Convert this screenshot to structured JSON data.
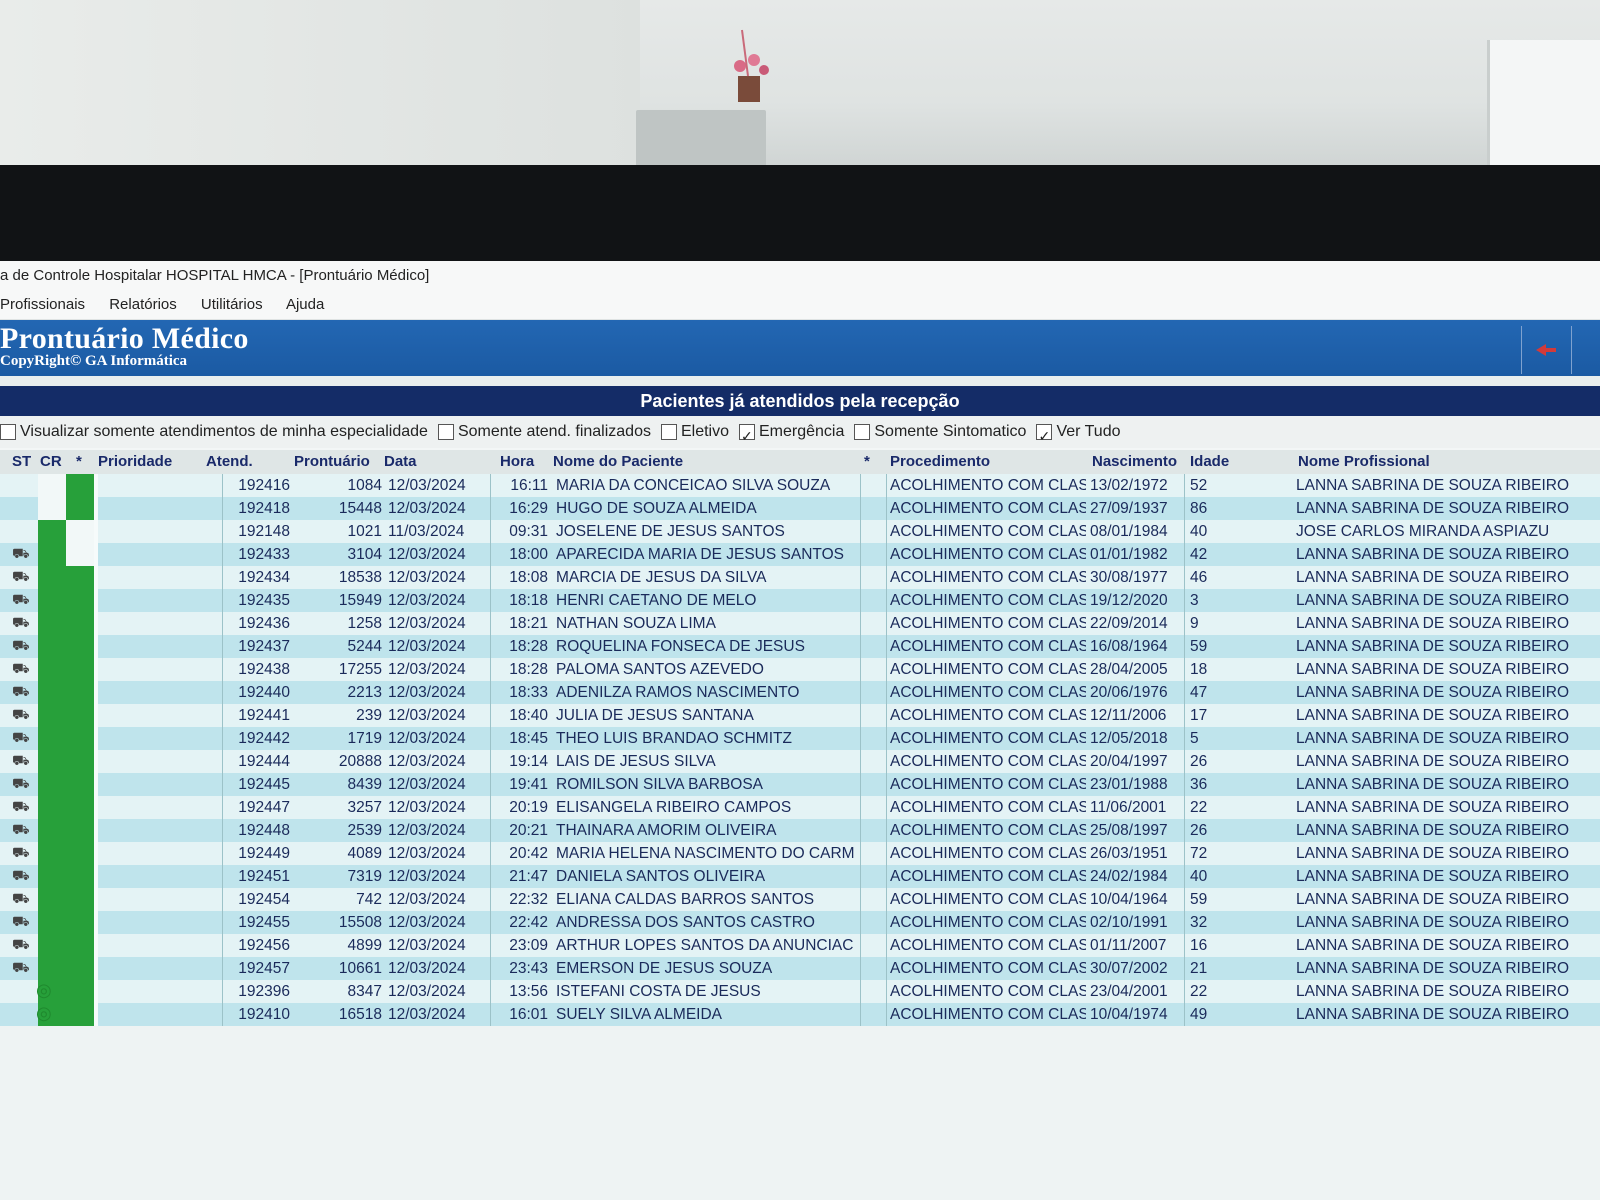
{
  "window": {
    "title": "a de Controle Hospitalar HOSPITAL HMCA - [Prontuário Médico]"
  },
  "menu": [
    "Profissionais",
    "Relatórios",
    "Utilitários",
    "Ajuda"
  ],
  "banner": {
    "title": "Prontuário Médico",
    "subtitle": "CopyRight© GA Informática"
  },
  "section_title": "Pacientes já atendidos pela recepção",
  "filters": [
    {
      "label": "Visualizar somente atendimentos de minha especialidade",
      "checked": false
    },
    {
      "label": "Somente atend. finalizados",
      "checked": false
    },
    {
      "label": "Eletivo",
      "checked": false
    },
    {
      "label": "Emergência",
      "checked": true
    },
    {
      "label": "Somente Sintomatico",
      "checked": false
    },
    {
      "label": "Ver Tudo",
      "checked": true
    }
  ],
  "columns": {
    "st": "ST",
    "cr": "CR",
    "star": "*",
    "prioridade": "Prioridade",
    "atend": "Atend.",
    "prontuario": "Prontuário",
    "data": "Data",
    "hora": "Hora",
    "nome": "Nome do Paciente",
    "star2": "*",
    "procedimento": "Procedimento",
    "nascimento": "Nascimento",
    "idade": "Idade",
    "profissional": "Nome Profissional"
  },
  "rows": [
    {
      "atend": "192416",
      "prontuario": "1084",
      "data": "12/03/2024",
      "hora": "16:11",
      "nome": "MARIA DA CONCEICAO SILVA SOUZA",
      "procedimento": "ACOLHIMENTO COM CLAS",
      "nascimento": "13/02/1972",
      "idade": "52",
      "profissional": "LANNA SABRINA DE SOUZA RIBEIRO"
    },
    {
      "atend": "192418",
      "prontuario": "15448",
      "data": "12/03/2024",
      "hora": "16:29",
      "nome": "HUGO DE SOUZA ALMEIDA",
      "procedimento": "ACOLHIMENTO COM CLAS",
      "nascimento": "27/09/1937",
      "idade": "86",
      "profissional": "LANNA SABRINA DE SOUZA RIBEIRO"
    },
    {
      "atend": "192148",
      "prontuario": "1021",
      "data": "11/03/2024",
      "hora": "09:31",
      "nome": "JOSELENE DE JESUS SANTOS",
      "procedimento": "ACOLHIMENTO COM CLAS",
      "nascimento": "08/01/1984",
      "idade": "40",
      "profissional": "JOSE CARLOS MIRANDA ASPIAZU"
    },
    {
      "atend": "192433",
      "prontuario": "3104",
      "data": "12/03/2024",
      "hora": "18:00",
      "nome": "APARECIDA MARIA DE JESUS SANTOS",
      "procedimento": "ACOLHIMENTO COM CLAS",
      "nascimento": "01/01/1982",
      "idade": "42",
      "profissional": "LANNA SABRINA DE SOUZA RIBEIRO"
    },
    {
      "atend": "192434",
      "prontuario": "18538",
      "data": "12/03/2024",
      "hora": "18:08",
      "nome": "MARCIA DE JESUS DA SILVA",
      "procedimento": "ACOLHIMENTO COM CLAS",
      "nascimento": "30/08/1977",
      "idade": "46",
      "profissional": "LANNA SABRINA DE SOUZA RIBEIRO"
    },
    {
      "atend": "192435",
      "prontuario": "15949",
      "data": "12/03/2024",
      "hora": "18:18",
      "nome": "HENRI CAETANO DE MELO",
      "procedimento": "ACOLHIMENTO COM CLAS",
      "nascimento": "19/12/2020",
      "idade": "3",
      "profissional": "LANNA SABRINA DE SOUZA RIBEIRO"
    },
    {
      "atend": "192436",
      "prontuario": "1258",
      "data": "12/03/2024",
      "hora": "18:21",
      "nome": "NATHAN SOUZA LIMA",
      "procedimento": "ACOLHIMENTO COM CLAS",
      "nascimento": "22/09/2014",
      "idade": "9",
      "profissional": "LANNA SABRINA DE SOUZA RIBEIRO"
    },
    {
      "atend": "192437",
      "prontuario": "5244",
      "data": "12/03/2024",
      "hora": "18:28",
      "nome": "ROQUELINA FONSECA DE JESUS",
      "procedimento": "ACOLHIMENTO COM CLAS",
      "nascimento": "16/08/1964",
      "idade": "59",
      "profissional": "LANNA SABRINA DE SOUZA RIBEIRO"
    },
    {
      "atend": "192438",
      "prontuario": "17255",
      "data": "12/03/2024",
      "hora": "18:28",
      "nome": "PALOMA SANTOS AZEVEDO",
      "procedimento": "ACOLHIMENTO COM CLAS",
      "nascimento": "28/04/2005",
      "idade": "18",
      "profissional": "LANNA SABRINA DE SOUZA RIBEIRO"
    },
    {
      "atend": "192440",
      "prontuario": "2213",
      "data": "12/03/2024",
      "hora": "18:33",
      "nome": "ADENILZA RAMOS NASCIMENTO",
      "procedimento": "ACOLHIMENTO COM CLAS",
      "nascimento": "20/06/1976",
      "idade": "47",
      "profissional": "LANNA SABRINA DE SOUZA RIBEIRO"
    },
    {
      "atend": "192441",
      "prontuario": "239",
      "data": "12/03/2024",
      "hora": "18:40",
      "nome": "JULIA DE JESUS SANTANA",
      "procedimento": "ACOLHIMENTO COM CLAS",
      "nascimento": "12/11/2006",
      "idade": "17",
      "profissional": "LANNA SABRINA DE SOUZA RIBEIRO"
    },
    {
      "atend": "192442",
      "prontuario": "1719",
      "data": "12/03/2024",
      "hora": "18:45",
      "nome": "THEO LUIS BRANDAO SCHMITZ",
      "procedimento": "ACOLHIMENTO COM CLAS",
      "nascimento": "12/05/2018",
      "idade": "5",
      "profissional": "LANNA SABRINA DE SOUZA RIBEIRO"
    },
    {
      "atend": "192444",
      "prontuario": "20888",
      "data": "12/03/2024",
      "hora": "19:14",
      "nome": "LAIS DE JESUS SILVA",
      "procedimento": "ACOLHIMENTO COM CLAS",
      "nascimento": "20/04/1997",
      "idade": "26",
      "profissional": "LANNA SABRINA DE SOUZA RIBEIRO"
    },
    {
      "atend": "192445",
      "prontuario": "8439",
      "data": "12/03/2024",
      "hora": "19:41",
      "nome": "ROMILSON SILVA BARBOSA",
      "procedimento": "ACOLHIMENTO COM CLAS",
      "nascimento": "23/01/1988",
      "idade": "36",
      "profissional": "LANNA SABRINA DE SOUZA RIBEIRO"
    },
    {
      "atend": "192447",
      "prontuario": "3257",
      "data": "12/03/2024",
      "hora": "20:19",
      "nome": "ELISANGELA RIBEIRO CAMPOS",
      "procedimento": "ACOLHIMENTO COM CLAS",
      "nascimento": "11/06/2001",
      "idade": "22",
      "profissional": "LANNA SABRINA DE SOUZA RIBEIRO"
    },
    {
      "atend": "192448",
      "prontuario": "2539",
      "data": "12/03/2024",
      "hora": "20:21",
      "nome": "THAINARA AMORIM OLIVEIRA",
      "procedimento": "ACOLHIMENTO COM CLAS",
      "nascimento": "25/08/1997",
      "idade": "26",
      "profissional": "LANNA SABRINA DE SOUZA RIBEIRO"
    },
    {
      "atend": "192449",
      "prontuario": "4089",
      "data": "12/03/2024",
      "hora": "20:42",
      "nome": "MARIA HELENA NASCIMENTO DO CARM",
      "procedimento": "ACOLHIMENTO COM CLAS",
      "nascimento": "26/03/1951",
      "idade": "72",
      "profissional": "LANNA SABRINA DE SOUZA RIBEIRO"
    },
    {
      "atend": "192451",
      "prontuario": "7319",
      "data": "12/03/2024",
      "hora": "21:47",
      "nome": "DANIELA SANTOS OLIVEIRA",
      "procedimento": "ACOLHIMENTO COM CLAS",
      "nascimento": "24/02/1984",
      "idade": "40",
      "profissional": "LANNA SABRINA DE SOUZA RIBEIRO"
    },
    {
      "atend": "192454",
      "prontuario": "742",
      "data": "12/03/2024",
      "hora": "22:32",
      "nome": "ELIANA CALDAS BARROS SANTOS",
      "procedimento": "ACOLHIMENTO COM CLAS",
      "nascimento": "10/04/1964",
      "idade": "59",
      "profissional": "LANNA SABRINA DE SOUZA RIBEIRO"
    },
    {
      "atend": "192455",
      "prontuario": "15508",
      "data": "12/03/2024",
      "hora": "22:42",
      "nome": "ANDRESSA DOS SANTOS CASTRO",
      "procedimento": "ACOLHIMENTO COM CLAS",
      "nascimento": "02/10/1991",
      "idade": "32",
      "profissional": "LANNA SABRINA DE SOUZA RIBEIRO"
    },
    {
      "atend": "192456",
      "prontuario": "4899",
      "data": "12/03/2024",
      "hora": "23:09",
      "nome": "ARTHUR LOPES SANTOS DA ANUNCIAC",
      "procedimento": "ACOLHIMENTO COM CLAS",
      "nascimento": "01/11/2007",
      "idade": "16",
      "profissional": "LANNA SABRINA DE SOUZA RIBEIRO"
    },
    {
      "atend": "192457",
      "prontuario": "10661",
      "data": "12/03/2024",
      "hora": "23:43",
      "nome": "EMERSON DE JESUS SOUZA",
      "procedimento": "ACOLHIMENTO COM CLAS",
      "nascimento": "30/07/2002",
      "idade": "21",
      "profissional": "LANNA SABRINA DE SOUZA RIBEIRO"
    },
    {
      "atend": "192396",
      "prontuario": "8347",
      "data": "12/03/2024",
      "hora": "13:56",
      "nome": "ISTEFANI COSTA DE JESUS",
      "procedimento": "ACOLHIMENTO COM CLAS",
      "nascimento": "23/04/2001",
      "idade": "22",
      "profissional": "LANNA SABRINA DE SOUZA RIBEIRO"
    },
    {
      "atend": "192410",
      "prontuario": "16518",
      "data": "12/03/2024",
      "hora": "16:01",
      "nome": "SUELY SILVA ALMEIDA",
      "procedimento": "ACOLHIMENTO COM CLAS",
      "nascimento": "10/04/1974",
      "idade": "49",
      "profissional": "LANNA SABRINA DE SOUZA RIBEIRO"
    }
  ],
  "colors": {
    "banner_blue": "#1b5aa3",
    "navy_header": "#142c67",
    "row_light": "#e4f3f5",
    "row_dark": "#bfe4ec",
    "cr_green": "#27a03a"
  }
}
